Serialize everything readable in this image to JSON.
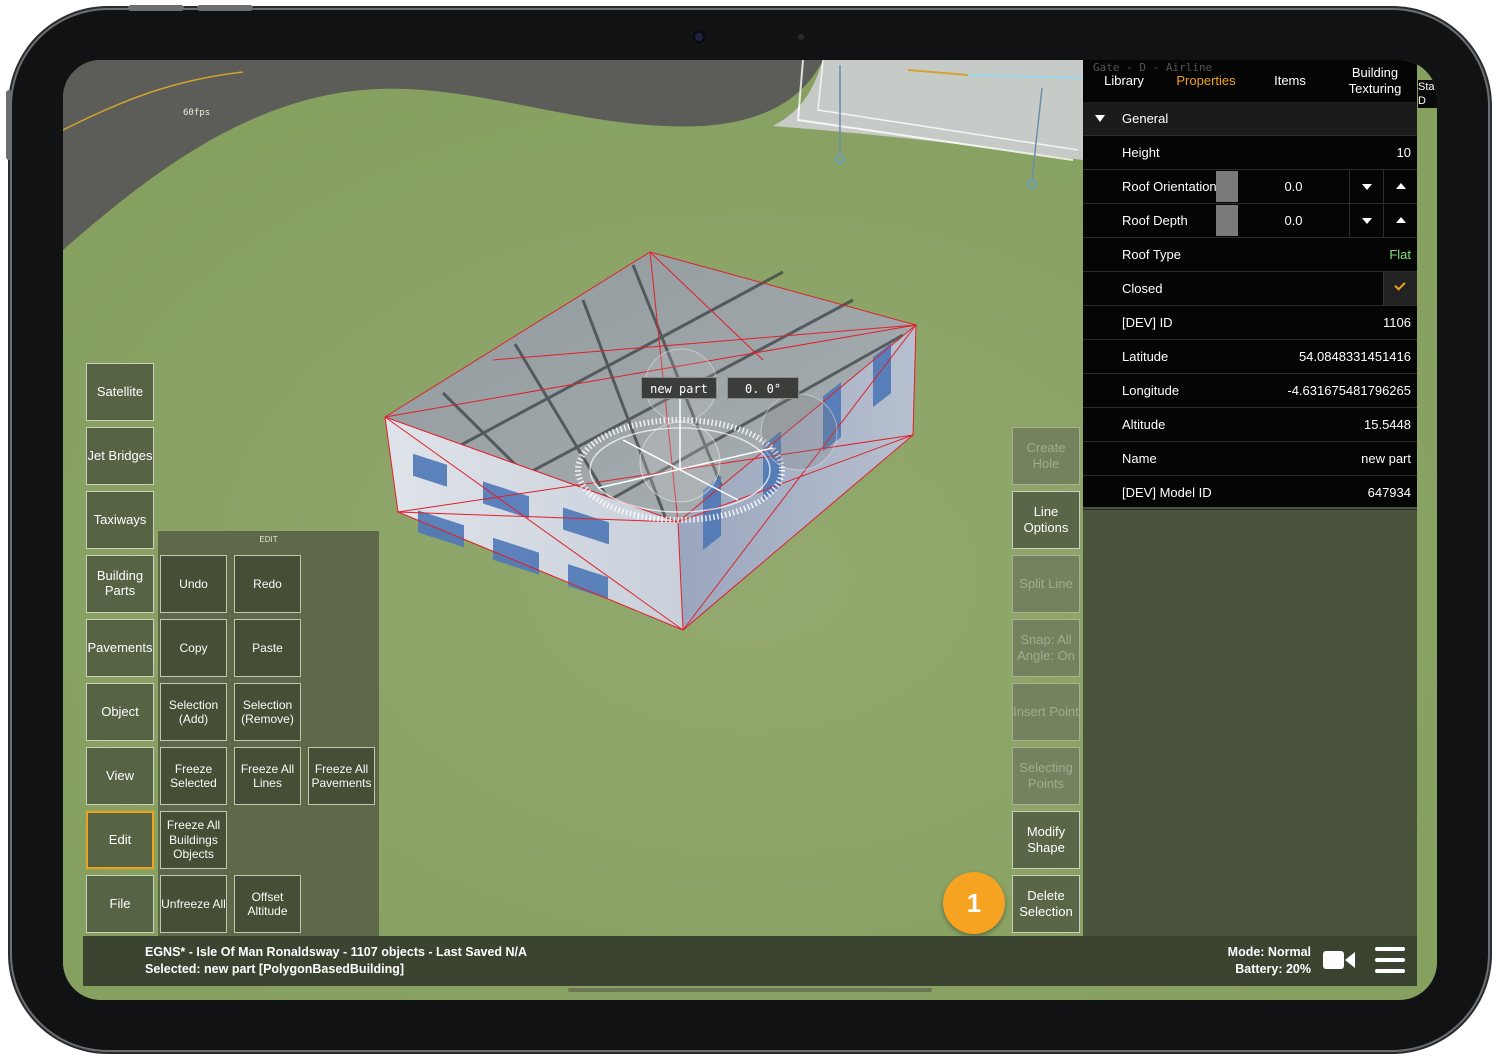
{
  "viewport": {
    "fps_label": "60fps",
    "ghost_label": "Gate - D - Airline",
    "gizmo": {
      "name_tag": "new part",
      "angle_tag": "0. 0°"
    }
  },
  "left_menu": [
    {
      "label": "Satellite"
    },
    {
      "label": "Jet Bridges"
    },
    {
      "label": "Taxiways"
    },
    {
      "label": "Building Parts"
    },
    {
      "label": "Pavements"
    },
    {
      "label": "Object"
    },
    {
      "label": "View"
    },
    {
      "label": "Edit",
      "active": true
    },
    {
      "label": "File"
    }
  ],
  "edit_panel": {
    "title": "EDIT",
    "buttons": {
      "undo": "Undo",
      "redo": "Redo",
      "copy": "Copy",
      "paste": "Paste",
      "selection_add": "Selection (Add)",
      "selection_remove": "Selection (Remove)",
      "freeze_selected": "Freeze Selected",
      "freeze_all_lines": "Freeze All Lines",
      "freeze_all_pavements": "Freeze All Pavements",
      "freeze_all_buildings": "Freeze All Buildings Objects",
      "unfreeze_all": "Unfreeze All",
      "offset_altitude": "Offset Altitude"
    }
  },
  "right_tools": {
    "create_hole": {
      "label": "Create Hole",
      "enabled": false
    },
    "line_options": {
      "label": "Line Options",
      "enabled": true
    },
    "split_line": {
      "label": "Split Line",
      "enabled": false
    },
    "snap": {
      "label": "Snap: All Angle: On",
      "enabled": false
    },
    "insert_point": {
      "label": "Insert Point",
      "enabled": false
    },
    "selecting_points": {
      "label": "Selecting Points",
      "enabled": false
    },
    "modify_shape": {
      "label": "Modify Shape",
      "enabled": true
    },
    "delete_selection": {
      "label": "Delete Selection",
      "enabled": true
    }
  },
  "properties": {
    "tabs": {
      "library": "Library",
      "properties": "Properties",
      "items": "Items",
      "building_texturing": "Building Texturing",
      "cut_tab": "Sta D"
    },
    "active_tab": "Properties",
    "section": "General",
    "rows": {
      "height": {
        "label": "Height",
        "value": "10"
      },
      "roof_orientation": {
        "label": "Roof Orientation",
        "value": "0.0"
      },
      "roof_depth": {
        "label": "Roof Depth",
        "value": "0.0"
      },
      "roof_type": {
        "label": "Roof Type",
        "value": "Flat"
      },
      "closed": {
        "label": "Closed",
        "checked": true
      },
      "dev_id": {
        "label": "[DEV] ID",
        "value": "1106"
      },
      "latitude": {
        "label": "Latitude",
        "value": "54.0848331451416"
      },
      "longitude": {
        "label": "Longitude",
        "value": "-4.631675481796265"
      },
      "altitude": {
        "label": "Altitude",
        "value": "15.5448"
      },
      "name": {
        "label": "Name",
        "value": "new part"
      },
      "dev_model_id": {
        "label": "[DEV] Model ID",
        "value": "647934"
      }
    }
  },
  "status": {
    "line1": "EGNS* - Isle Of Man Ronaldsway - 1107 objects - Last Saved N/A",
    "line2": "Selected: new part [PolygonBasedBuilding]",
    "mode": "Mode: Normal",
    "battery": "Battery: 20%"
  },
  "callout": {
    "number": "1",
    "color": "#f5a321"
  },
  "colors": {
    "accent": "#f0a21e",
    "roof_type_value": "#7ee07e",
    "ground": "#8ea468"
  }
}
